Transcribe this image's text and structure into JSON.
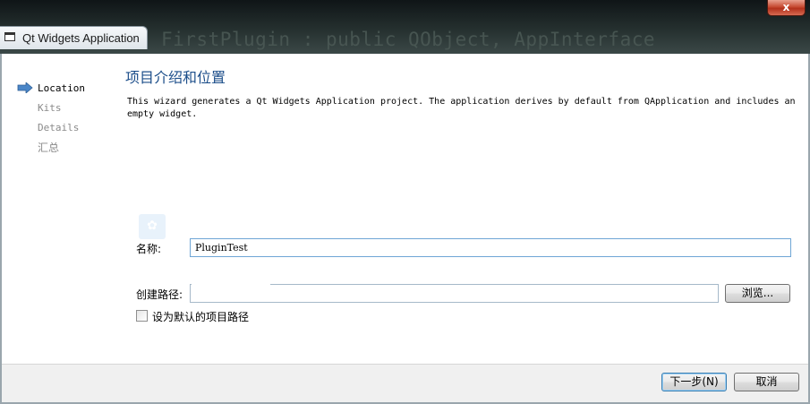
{
  "window": {
    "title": "Qt Widgets Application",
    "close_glyph": "x",
    "background_code": "FirstPlugin : public QObject, AppInterface"
  },
  "sidebar": {
    "steps": [
      {
        "label": "Location",
        "active": true
      },
      {
        "label": "Kits",
        "active": false
      },
      {
        "label": "Details",
        "active": false
      },
      {
        "label": "汇总",
        "active": false
      }
    ]
  },
  "page": {
    "title": "项目介绍和位置",
    "description": "This wizard generates a Qt Widgets Application project. The application derives by default from QApplication and includes an empty widget."
  },
  "form": {
    "name_label": "名称:",
    "name_value": "PluginTest",
    "path_label": "创建路径:",
    "path_value": "",
    "browse_label": "浏览...",
    "default_path_label": "设为默认的项目路径",
    "default_path_checked": false
  },
  "footer": {
    "next_label": "下一步(N)",
    "cancel_label": "取消"
  },
  "colors": {
    "title_blue": "#1c4e8a",
    "arrow_blue": "#4a86c8",
    "close_red": "#c74a32"
  }
}
